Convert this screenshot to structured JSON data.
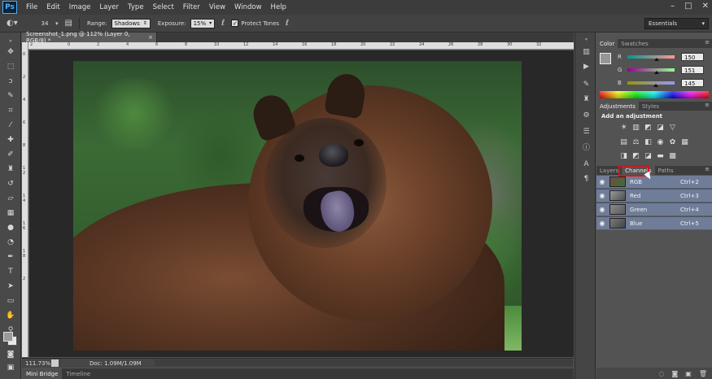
{
  "menubar": {
    "logo": "Ps",
    "items": [
      "File",
      "Edit",
      "Image",
      "Layer",
      "Type",
      "Select",
      "Filter",
      "View",
      "Window",
      "Help"
    ],
    "window_controls": [
      "–",
      "□",
      "✕"
    ]
  },
  "options": {
    "brush_size": "34",
    "range_label": "Range:",
    "range_value": "Shadows",
    "exposure_label": "Exposure:",
    "exposure_value": "15%",
    "protect_tones_label": "Protect Tones",
    "protect_tones_checked": true,
    "workspace": "Essentials"
  },
  "document": {
    "tab_title": "Screenshot_1.png @ 112% (Layer 0, RGB/8) *",
    "close": "×"
  },
  "ruler_top_ticks": [
    "2",
    "0",
    "2",
    "4",
    "6",
    "8",
    "10",
    "12",
    "14",
    "16",
    "18",
    "20",
    "22",
    "24",
    "26",
    "28",
    "30",
    "32"
  ],
  "ruler_left_ticks": [
    "0",
    "2",
    "4",
    "6",
    "8",
    "1",
    "2",
    "1",
    "4",
    "1",
    "6",
    "1",
    "8",
    "2"
  ],
  "status": {
    "zoom": "111.73%",
    "doc_info": "Doc: 1.09M/1.09M",
    "play": "▶"
  },
  "bottom_tabs": [
    "Mini Bridge",
    "Timeline"
  ],
  "color_panel": {
    "tabs": [
      "Color",
      "Swatches"
    ],
    "r_label": "R",
    "r_value": "150",
    "g_label": "G",
    "g_value": "151",
    "b_label": "B",
    "b_value": "145",
    "fg_color": "#969791"
  },
  "adjustments": {
    "tabs": [
      "Adjustments",
      "Styles"
    ],
    "heading": "Add an adjustment"
  },
  "channels_panel": {
    "tabs": [
      "Layers",
      "Channels",
      "Paths"
    ],
    "rows": [
      {
        "name": "RGB",
        "shortcut": "Ctrl+2"
      },
      {
        "name": "Red",
        "shortcut": "Ctrl+3"
      },
      {
        "name": "Green",
        "shortcut": "Ctrl+4"
      },
      {
        "name": "Blue",
        "shortcut": "Ctrl+5"
      }
    ]
  },
  "colors": {
    "accent_highlight": "#e01212",
    "selected_row": "#6f7d99",
    "panel_bg": "#535353"
  }
}
